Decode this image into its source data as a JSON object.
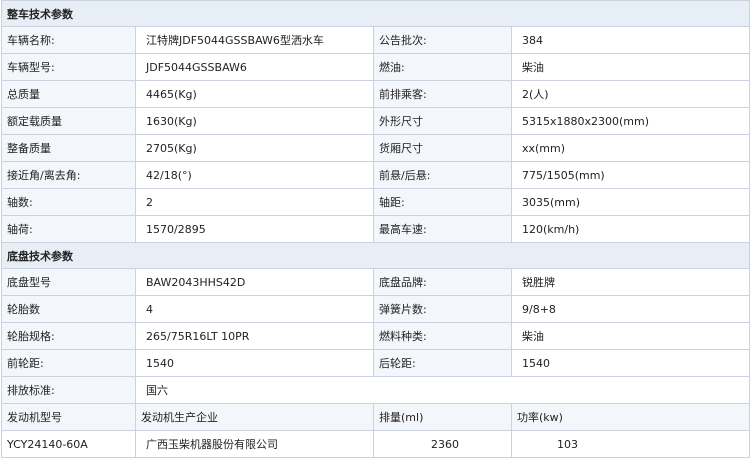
{
  "vehicle": {
    "section_title": "整车技术参数",
    "rows": [
      {
        "l1": "车辆名称:",
        "v1": "江特牌JDF5044GSSBAW6型洒水车",
        "l2": "公告批次:",
        "v2": "384"
      },
      {
        "l1": "车辆型号:",
        "v1": "JDF5044GSSBAW6",
        "l2": "燃油:",
        "v2": "柴油"
      },
      {
        "l1": "总质量",
        "v1": "4465(Kg)",
        "l2": "前排乘客:",
        "v2": "2(人)"
      },
      {
        "l1": "额定载质量",
        "v1": "1630(Kg)",
        "l2": "外形尺寸",
        "v2": "5315x1880x2300(mm)"
      },
      {
        "l1": "整备质量",
        "v1": "2705(Kg)",
        "l2": "货厢尺寸",
        "v2": "xx(mm)"
      },
      {
        "l1": "接近角/离去角:",
        "v1": "42/18(°)",
        "l2": "前悬/后悬:",
        "v2": "775/1505(mm)"
      },
      {
        "l1": "轴数:",
        "v1": "2",
        "l2": "轴距:",
        "v2": "3035(mm)"
      },
      {
        "l1": "轴荷:",
        "v1": "1570/2895",
        "l2": "最高车速:",
        "v2": "120(km/h)"
      }
    ]
  },
  "chassis": {
    "section_title": "底盘技术参数",
    "rows": [
      {
        "l1": "底盘型号",
        "v1": "BAW2043HHS42D",
        "l2": "底盘品牌:",
        "v2": "锐胜牌"
      },
      {
        "l1": "轮胎数",
        "v1": "4",
        "l2": "弹簧片数:",
        "v2": "9/8+8"
      },
      {
        "l1": "轮胎规格:",
        "v1": "265/75R16LT 10PR",
        "l2": "燃料种类:",
        "v2": "柴油"
      },
      {
        "l1": "前轮距:",
        "v1": "1540",
        "l2": "后轮距:",
        "v2": "1540"
      }
    ],
    "emission": {
      "label": "排放标准:",
      "value": "国六"
    },
    "engine_header": {
      "h1": "发动机型号",
      "h2": "发动机生产企业",
      "h3": "排量(ml)",
      "h4": "功率(kw)"
    },
    "engine_row": {
      "model": "YCY24140-60A",
      "maker": "广西玉柴机器股份有限公司",
      "displacement": "2360",
      "power": "103"
    }
  }
}
